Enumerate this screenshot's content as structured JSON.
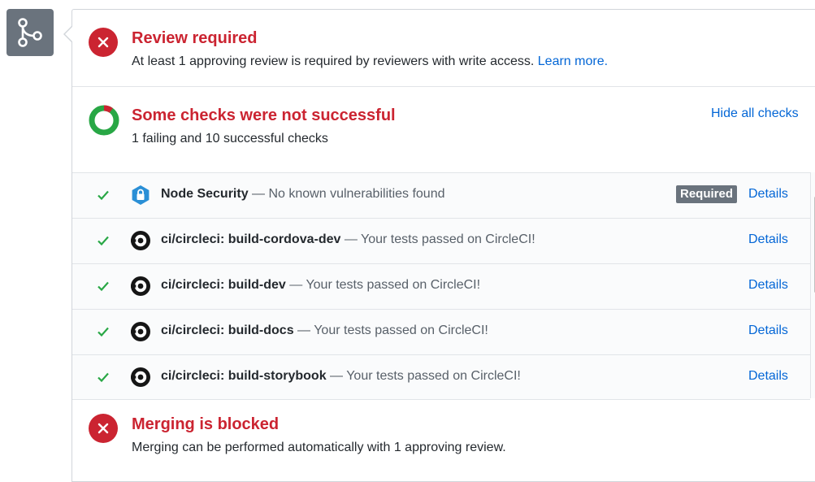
{
  "review": {
    "title": "Review required",
    "description": "At least 1 approving review is required by reviewers with write access.",
    "learn_more": "Learn more."
  },
  "checks": {
    "title": "Some checks were not successful",
    "summary": "1 failing and 10 successful checks",
    "toggle_label": "Hide all checks",
    "items": [
      {
        "name": "Node Security",
        "separator": " — ",
        "description": "No known vulnerabilities found",
        "required_label": "Required",
        "details_label": "Details",
        "icon": "node-security-shield-icon",
        "status": "success"
      },
      {
        "name": "ci/circleci: build-cordova-dev",
        "separator": " — ",
        "description": "Your tests passed on CircleCI!",
        "details_label": "Details",
        "icon": "circleci-icon",
        "status": "success"
      },
      {
        "name": "ci/circleci: build-dev",
        "separator": " — ",
        "description": "Your tests passed on CircleCI!",
        "details_label": "Details",
        "icon": "circleci-icon",
        "status": "success"
      },
      {
        "name": "ci/circleci: build-docs",
        "separator": " — ",
        "description": "Your tests passed on CircleCI!",
        "details_label": "Details",
        "icon": "circleci-icon",
        "status": "success"
      },
      {
        "name": "ci/circleci: build-storybook",
        "separator": " — ",
        "description": "Your tests passed on CircleCI!",
        "details_label": "Details",
        "icon": "circleci-icon",
        "status": "success"
      }
    ]
  },
  "merge": {
    "title": "Merging is blocked",
    "description": "Merging can be performed automatically with 1 approving review."
  },
  "colors": {
    "failure_red": "#cb2431",
    "success_green": "#28a745",
    "link_blue": "#0366d6",
    "badge_gray": "#6a737d",
    "node_security_blue": "#2a8fd6"
  }
}
